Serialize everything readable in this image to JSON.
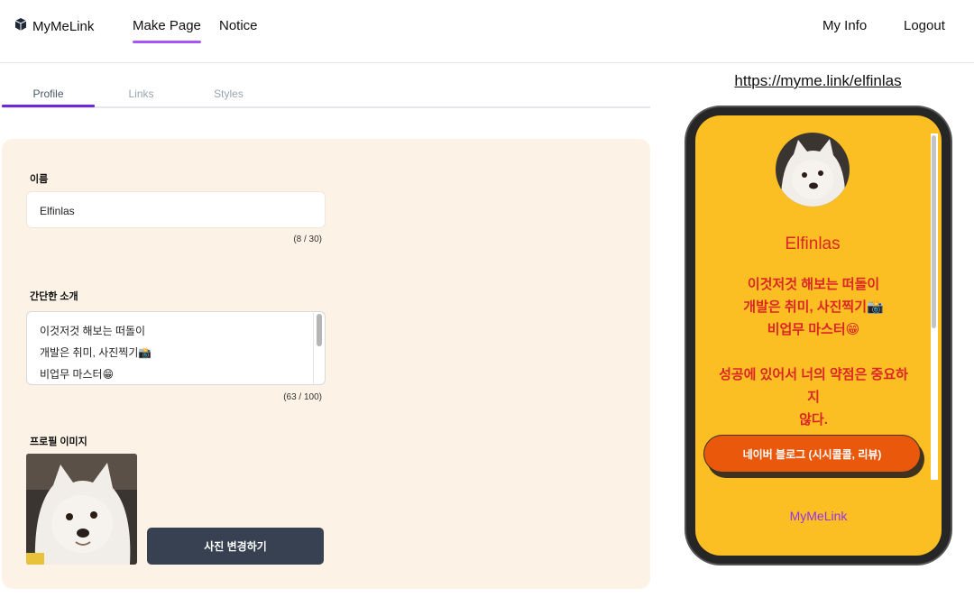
{
  "nav": {
    "logo": "MyMeLink",
    "links": [
      "Make Page",
      "Notice"
    ],
    "right": [
      "My Info",
      "Logout"
    ]
  },
  "tabs": [
    "Profile",
    "Links",
    "Styles"
  ],
  "editor": {
    "name_label": "이름",
    "name_value": "Elfinlas",
    "name_counter": "(8 / 30)",
    "intro_label": "간단한 소개",
    "intro_lines": [
      "이것저것 해보는 떠돌이",
      "개발은 취미, 사진찍기📸",
      "비업무 마스터😁"
    ],
    "intro_counter": "(63 / 100)",
    "image_label": "프로필 이미지",
    "change_button": "사진 변경하기"
  },
  "preview": {
    "url": "https://myme.link/elfinlas",
    "name": "Elfinlas",
    "bio_lines": [
      "이것저것 해보는 떠돌이",
      "개발은 취미, 사진찍기📸",
      "비업무 마스터😁",
      "",
      "성공에 있어서 너의 약점은 중요하지",
      "않다."
    ],
    "link_button": "네이버 블로그 (시시콜콜, 리뷰)",
    "footer": "MyMeLink"
  },
  "colors": {
    "accent": "#a855f7",
    "tab_active": "#6d28d9",
    "editor_bg": "#fdf2e6",
    "button_dark": "#374151",
    "preview_bg": "#fbbf24",
    "preview_text": "#dc2626",
    "preview_link": "#ea580c",
    "footer_text": "#9333ea"
  }
}
